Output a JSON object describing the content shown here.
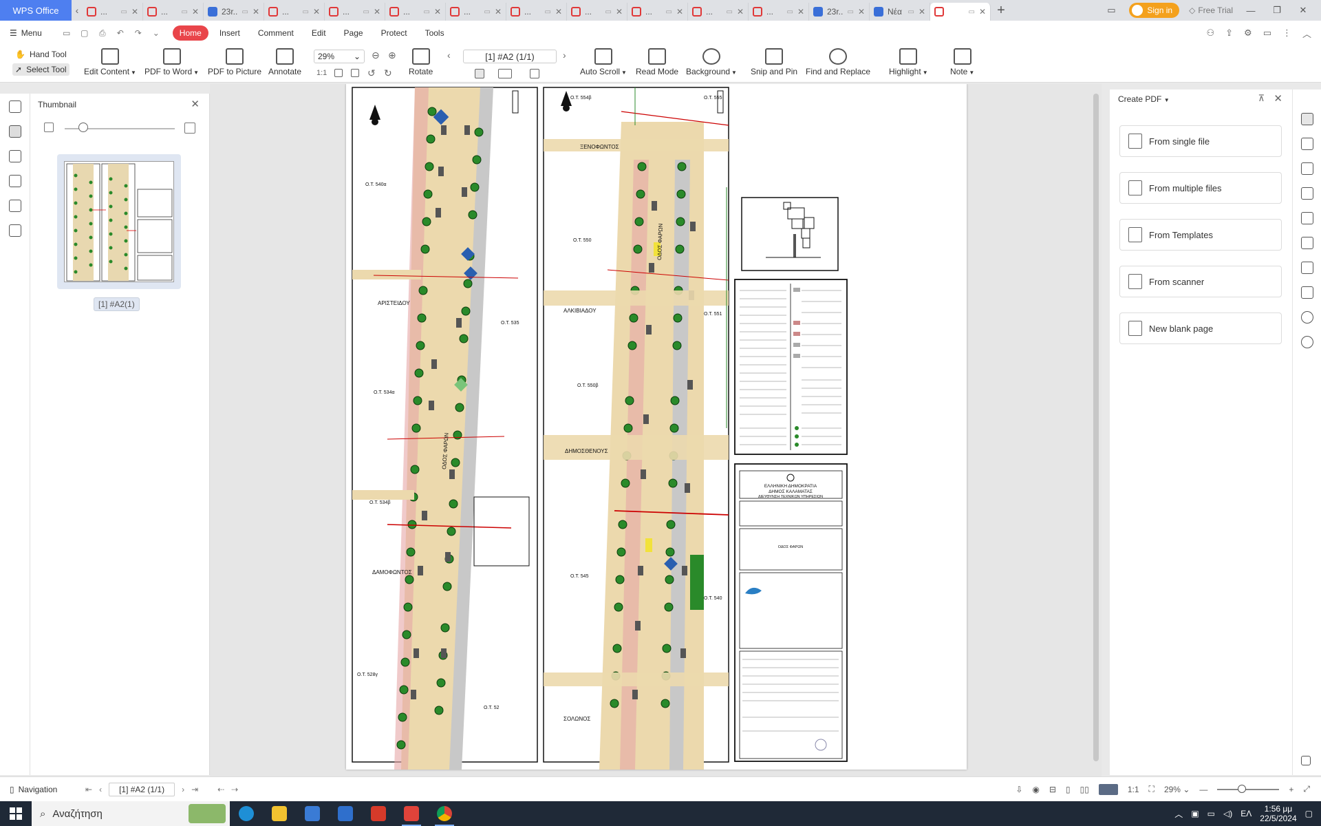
{
  "app": {
    "logo": "WPS Office",
    "tabs": [
      {
        "type": "pdf",
        "label": "..."
      },
      {
        "type": "pdf",
        "label": "..."
      },
      {
        "type": "doc",
        "label": "23r..."
      },
      {
        "type": "pdf",
        "label": "..."
      },
      {
        "type": "pdf",
        "label": "..."
      },
      {
        "type": "pdf",
        "label": "..."
      },
      {
        "type": "pdf",
        "label": "..."
      },
      {
        "type": "pdf",
        "label": "..."
      },
      {
        "type": "pdf",
        "label": "..."
      },
      {
        "type": "pdf",
        "label": "..."
      },
      {
        "type": "pdf",
        "label": "..."
      },
      {
        "type": "pdf",
        "label": "..."
      },
      {
        "type": "doc",
        "label": "23r..."
      },
      {
        "type": "doc",
        "label": "Νέα"
      },
      {
        "type": "pdf",
        "label": "",
        "active": true
      }
    ],
    "sign_in": "Sign in",
    "free_trial": "Free Trial"
  },
  "menu": {
    "menu_label": "Menu",
    "tabs": [
      "Home",
      "Insert",
      "Comment",
      "Edit",
      "Page",
      "Protect",
      "Tools"
    ],
    "active_tab": "Home"
  },
  "ribbon": {
    "hand_tool": "Hand Tool",
    "select_tool": "Select Tool",
    "edit_content": "Edit Content",
    "pdf_to_word": "PDF to Word",
    "pdf_to_picture": "PDF to Picture",
    "annotate": "Annotate",
    "zoom": "29%",
    "rotate": "Rotate",
    "page_indicator": "[1] #A2 (1/1)",
    "auto_scroll": "Auto Scroll",
    "read_mode": "Read Mode",
    "background": "Background",
    "snip_and_pin": "Snip and Pin",
    "find_and_replace": "Find and Replace",
    "highlight": "Highlight",
    "note": "Note"
  },
  "thumbnail_panel": {
    "title": "Thumbnail",
    "page_label": "[1] #A2(1)"
  },
  "create_pdf": {
    "title": "Create PDF",
    "options": [
      "From single file",
      "From multiple files",
      "From Templates",
      "From scanner",
      "New blank page"
    ]
  },
  "document": {
    "street_labels": [
      "ΞΕΝΟΦΩΝΤΟΣ",
      "ΑΡΙΣΤΕΙΔΟΥ",
      "ΑΛΚΙΒΙΑΔΟΥ",
      "ΔΗΜΟΣΘΕΝΟΥΣ",
      "ΔΑΜΟΦΩΝΤΟΣ",
      "ΣΟΛΩΝΟΣ"
    ],
    "block_labels": [
      "Ο.Τ. 540α",
      "Ο.Τ. 535",
      "Ο.Τ. 534α",
      "Ο.Τ. 534β",
      "Ο.Τ. 528γ",
      "Ο.Τ. 52",
      "Ο.Τ. 554β",
      "Ο.Τ. 555",
      "Ο.Τ. 550",
      "Ο.Τ. 551",
      "Ο.Τ. 550β",
      "Ο.Τ. 545",
      "Ο.Τ. 540"
    ],
    "road_name_left": "ΟΔΟΣ ΦΑΡΩΝ",
    "road_name_right": "ΟΔΟΣ ΦΑΡΩΝ",
    "title_block": {
      "country": "ΕΛΛΗΝΙΚΗ ΔΗΜΟΚΡΑΤΙΑ",
      "municipality": "ΔΗΜΟΣ ΚΑΛΑΜΑΤΑΣ",
      "department": "ΔΙΕΥΘΥΝΣΗ ΤΕΧΝΙΚΩΝ ΥΠΗΡΕΣΙΩΝ",
      "road": "ΟΔΟΣ ΦΑΡΩΝ"
    }
  },
  "status": {
    "navigation": "Navigation",
    "page": "[1] #A2 (1/1)",
    "zoom": "29%"
  },
  "taskbar": {
    "search_placeholder": "Αναζήτηση",
    "lang": "ΕΛ",
    "time": "1:56 μμ",
    "date": "22/5/2024"
  }
}
